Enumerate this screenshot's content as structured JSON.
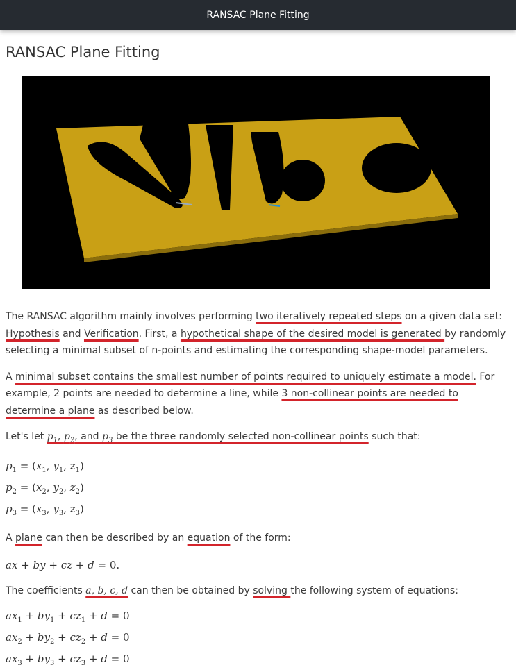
{
  "header": {
    "title": "RANSAC Plane Fitting"
  },
  "page": {
    "title": "RANSAC Plane Fitting"
  },
  "para1": {
    "a": "The RANSAC algorithm mainly involves performing ",
    "b": "two iteratively repeated steps",
    "c": " on a given data set: ",
    "d": "Hypothesis",
    "e": " and ",
    "f": "Verification",
    "g": ". First, a ",
    "h": "hypothetical shape of the desired model is generated ",
    "i": "by randomly selecting a minimal subset of n-points and estimating the corresponding shape-model parameters."
  },
  "para2": {
    "a": "A ",
    "b": "minimal subset contains the smallest number of points required to uniquely estimate a model.",
    "c": " For example, 2 points are needed to determine a line, while ",
    "d": "3 non-collinear points are needed to determine a plane",
    "e": " as described below."
  },
  "para3": {
    "a": "Let's let ",
    "p1": "p1",
    "comma1": ", ",
    "p2": "p2",
    "and": ", and ",
    "p3": "p3",
    "b": " be the three randomly selected non-collinear points",
    "c": " such that:"
  },
  "points": [
    "p1 = (x1, y1, z1)",
    "p2 = (x2, y2, z2)",
    "p3 = (x3, y3, z3)"
  ],
  "para4": {
    "a": "A ",
    "b": "plane",
    "c": " can then be described by an ",
    "d": "equation",
    "e": " of the form:"
  },
  "plane_eq": "ax + by + cz + d = 0.",
  "para5": {
    "a": "The coefficients ",
    "b": "a, b, c, d",
    "c": " can then be obtained by ",
    "d": "solving ",
    "e": "the following system of equations:"
  },
  "system": [
    "ax1 + by1 + cz1 + d = 0",
    "ax2 + by2 + cz2 + d = 0",
    "ax3 + by3 + cz3 + d = 0"
  ],
  "colors": {
    "underline": "#d3242b",
    "header_bg": "#262b31",
    "plate": "#c9a015"
  },
  "figure": {
    "icon": "plate-point-cloud-image"
  }
}
